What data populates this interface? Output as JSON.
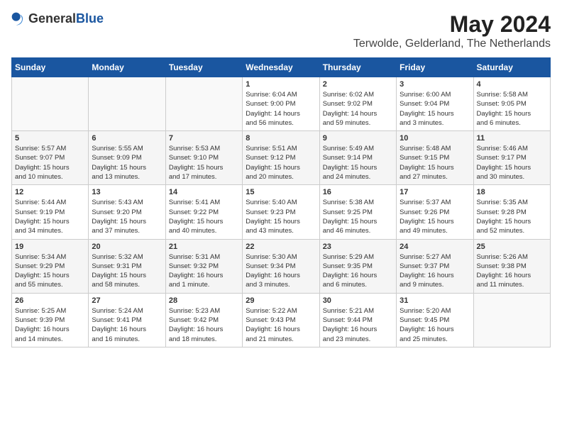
{
  "logo": {
    "general": "General",
    "blue": "Blue"
  },
  "title": "May 2024",
  "location": "Terwolde, Gelderland, The Netherlands",
  "weekdays": [
    "Sunday",
    "Monday",
    "Tuesday",
    "Wednesday",
    "Thursday",
    "Friday",
    "Saturday"
  ],
  "weeks": [
    [
      {
        "day": "",
        "info": ""
      },
      {
        "day": "",
        "info": ""
      },
      {
        "day": "",
        "info": ""
      },
      {
        "day": "1",
        "info": "Sunrise: 6:04 AM\nSunset: 9:00 PM\nDaylight: 14 hours\nand 56 minutes."
      },
      {
        "day": "2",
        "info": "Sunrise: 6:02 AM\nSunset: 9:02 PM\nDaylight: 14 hours\nand 59 minutes."
      },
      {
        "day": "3",
        "info": "Sunrise: 6:00 AM\nSunset: 9:04 PM\nDaylight: 15 hours\nand 3 minutes."
      },
      {
        "day": "4",
        "info": "Sunrise: 5:58 AM\nSunset: 9:05 PM\nDaylight: 15 hours\nand 6 minutes."
      }
    ],
    [
      {
        "day": "5",
        "info": "Sunrise: 5:57 AM\nSunset: 9:07 PM\nDaylight: 15 hours\nand 10 minutes."
      },
      {
        "day": "6",
        "info": "Sunrise: 5:55 AM\nSunset: 9:09 PM\nDaylight: 15 hours\nand 13 minutes."
      },
      {
        "day": "7",
        "info": "Sunrise: 5:53 AM\nSunset: 9:10 PM\nDaylight: 15 hours\nand 17 minutes."
      },
      {
        "day": "8",
        "info": "Sunrise: 5:51 AM\nSunset: 9:12 PM\nDaylight: 15 hours\nand 20 minutes."
      },
      {
        "day": "9",
        "info": "Sunrise: 5:49 AM\nSunset: 9:14 PM\nDaylight: 15 hours\nand 24 minutes."
      },
      {
        "day": "10",
        "info": "Sunrise: 5:48 AM\nSunset: 9:15 PM\nDaylight: 15 hours\nand 27 minutes."
      },
      {
        "day": "11",
        "info": "Sunrise: 5:46 AM\nSunset: 9:17 PM\nDaylight: 15 hours\nand 30 minutes."
      }
    ],
    [
      {
        "day": "12",
        "info": "Sunrise: 5:44 AM\nSunset: 9:19 PM\nDaylight: 15 hours\nand 34 minutes."
      },
      {
        "day": "13",
        "info": "Sunrise: 5:43 AM\nSunset: 9:20 PM\nDaylight: 15 hours\nand 37 minutes."
      },
      {
        "day": "14",
        "info": "Sunrise: 5:41 AM\nSunset: 9:22 PM\nDaylight: 15 hours\nand 40 minutes."
      },
      {
        "day": "15",
        "info": "Sunrise: 5:40 AM\nSunset: 9:23 PM\nDaylight: 15 hours\nand 43 minutes."
      },
      {
        "day": "16",
        "info": "Sunrise: 5:38 AM\nSunset: 9:25 PM\nDaylight: 15 hours\nand 46 minutes."
      },
      {
        "day": "17",
        "info": "Sunrise: 5:37 AM\nSunset: 9:26 PM\nDaylight: 15 hours\nand 49 minutes."
      },
      {
        "day": "18",
        "info": "Sunrise: 5:35 AM\nSunset: 9:28 PM\nDaylight: 15 hours\nand 52 minutes."
      }
    ],
    [
      {
        "day": "19",
        "info": "Sunrise: 5:34 AM\nSunset: 9:29 PM\nDaylight: 15 hours\nand 55 minutes."
      },
      {
        "day": "20",
        "info": "Sunrise: 5:32 AM\nSunset: 9:31 PM\nDaylight: 15 hours\nand 58 minutes."
      },
      {
        "day": "21",
        "info": "Sunrise: 5:31 AM\nSunset: 9:32 PM\nDaylight: 16 hours\nand 1 minute."
      },
      {
        "day": "22",
        "info": "Sunrise: 5:30 AM\nSunset: 9:34 PM\nDaylight: 16 hours\nand 3 minutes."
      },
      {
        "day": "23",
        "info": "Sunrise: 5:29 AM\nSunset: 9:35 PM\nDaylight: 16 hours\nand 6 minutes."
      },
      {
        "day": "24",
        "info": "Sunrise: 5:27 AM\nSunset: 9:37 PM\nDaylight: 16 hours\nand 9 minutes."
      },
      {
        "day": "25",
        "info": "Sunrise: 5:26 AM\nSunset: 9:38 PM\nDaylight: 16 hours\nand 11 minutes."
      }
    ],
    [
      {
        "day": "26",
        "info": "Sunrise: 5:25 AM\nSunset: 9:39 PM\nDaylight: 16 hours\nand 14 minutes."
      },
      {
        "day": "27",
        "info": "Sunrise: 5:24 AM\nSunset: 9:41 PM\nDaylight: 16 hours\nand 16 minutes."
      },
      {
        "day": "28",
        "info": "Sunrise: 5:23 AM\nSunset: 9:42 PM\nDaylight: 16 hours\nand 18 minutes."
      },
      {
        "day": "29",
        "info": "Sunrise: 5:22 AM\nSunset: 9:43 PM\nDaylight: 16 hours\nand 21 minutes."
      },
      {
        "day": "30",
        "info": "Sunrise: 5:21 AM\nSunset: 9:44 PM\nDaylight: 16 hours\nand 23 minutes."
      },
      {
        "day": "31",
        "info": "Sunrise: 5:20 AM\nSunset: 9:45 PM\nDaylight: 16 hours\nand 25 minutes."
      },
      {
        "day": "",
        "info": ""
      }
    ]
  ]
}
